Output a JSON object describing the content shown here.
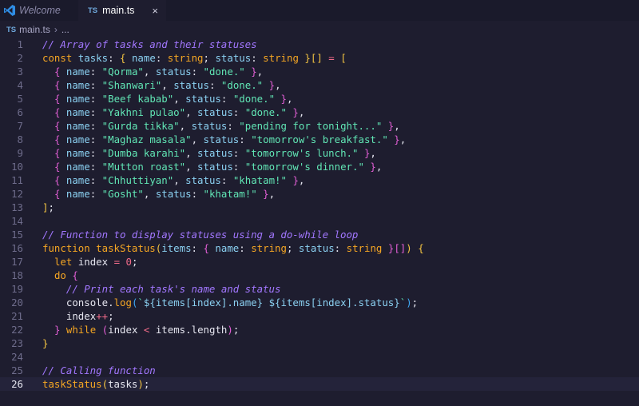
{
  "tabs": [
    {
      "label": "Welcome",
      "icon": "vscode-logo-icon",
      "active": false
    },
    {
      "label": "main.ts",
      "badge": "TS",
      "active": true,
      "close_icon": "×"
    }
  ],
  "breadcrumb": {
    "badge": "TS",
    "file": "main.ts",
    "separator": "›",
    "rest": "..."
  },
  "current_line": 26,
  "lines": [
    "// Array of tasks and their statuses",
    "const tasks: { name: string; status: string }[] = [",
    "  { name: \"Qorma\", status: \"done.\" },",
    "  { name: \"Shanwari\", status: \"done.\" },",
    "  { name: \"Beef kabab\", status: \"done.\" },",
    "  { name: \"Yakhni pulao\", status: \"done.\" },",
    "  { name: \"Gurda tikka\", status: \"pending for tonight...\" },",
    "  { name: \"Maghaz masala\", status: \"tomorrow's breakfast.\" },",
    "  { name: \"Dumba karahi\", status: \"tomorrow's lunch.\" },",
    "  { name: \"Mutton roast\", status: \"tomorrow's dinner.\" },",
    "  { name: \"Chhuttiyan\", status: \"khatam!\" },",
    "  { name: \"Gosht\", status: \"khatam!\" },",
    "];",
    "",
    "// Function to display statuses using a do-while loop",
    "function taskStatus(items: { name: string; status: string }[]) {",
    "  let index = 0;",
    "  do {",
    "    // Print each task's name and status",
    "    console.log(`${items[index].name} ${items[index].status}`);",
    "    index++;",
    "  } while (index < items.length);",
    "}",
    "",
    "// Calling function",
    "taskStatus(tasks);"
  ],
  "colors": {
    "background": "#1e1d2f",
    "comment": "#a277ff",
    "keyword": "#f5a623",
    "property": "#8bd1f2",
    "string": "#61e6b5",
    "number": "#f26c8a"
  }
}
